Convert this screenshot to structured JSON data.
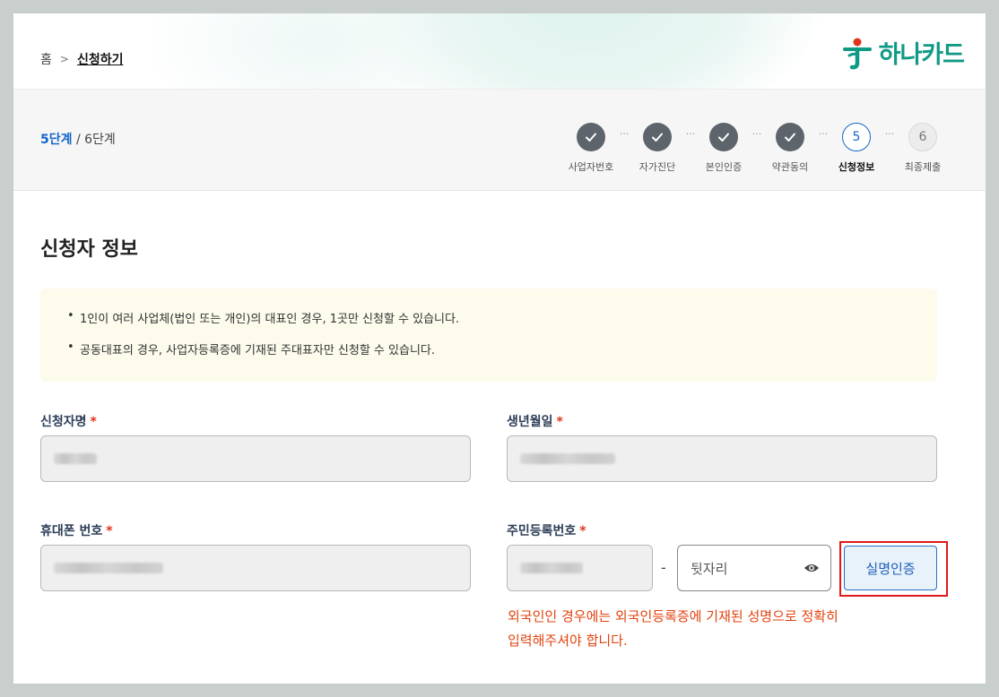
{
  "breadcrumb": {
    "home": "홈",
    "current": "신청하기"
  },
  "logo": {
    "text": "하나카드"
  },
  "progress": {
    "current": "5단계",
    "total": " / 6단계",
    "steps": [
      {
        "label": "사업자번호",
        "state": "done"
      },
      {
        "label": "자가진단",
        "state": "done"
      },
      {
        "label": "본인인증",
        "state": "done"
      },
      {
        "label": "약관동의",
        "state": "done"
      },
      {
        "label": "신청정보",
        "state": "active",
        "number": "5"
      },
      {
        "label": "최종제출",
        "state": "todo",
        "number": "6"
      }
    ],
    "dots": "···"
  },
  "section": {
    "title": "신청자 정보"
  },
  "notice": {
    "items": [
      "1인이 여러 사업체(법인 또는 개인)의 대표인 경우, 1곳만 신청할 수 있습니다.",
      "공동대표의 경우, 사업자등록증에 기재된 주대표자만 신청할 수 있습니다."
    ]
  },
  "form": {
    "required_mark": "*",
    "name": {
      "label": "신청자명"
    },
    "birth": {
      "label": "생년월일"
    },
    "phone": {
      "label": "휴대폰 번호"
    },
    "rrn": {
      "label": "주민등록번호",
      "separator": "-",
      "back_placeholder": "뒷자리"
    },
    "verify_button": "실명인증",
    "warning_line1": "외국인인 경우에는 외국인등록증에 기재된 성명으로 정확히",
    "warning_line2": "입력해주셔야 합니다."
  },
  "colors": {
    "accent": "#1a66c7",
    "brand": "#0f9a84",
    "error": "#e2331b",
    "highlight": "#e01818"
  }
}
